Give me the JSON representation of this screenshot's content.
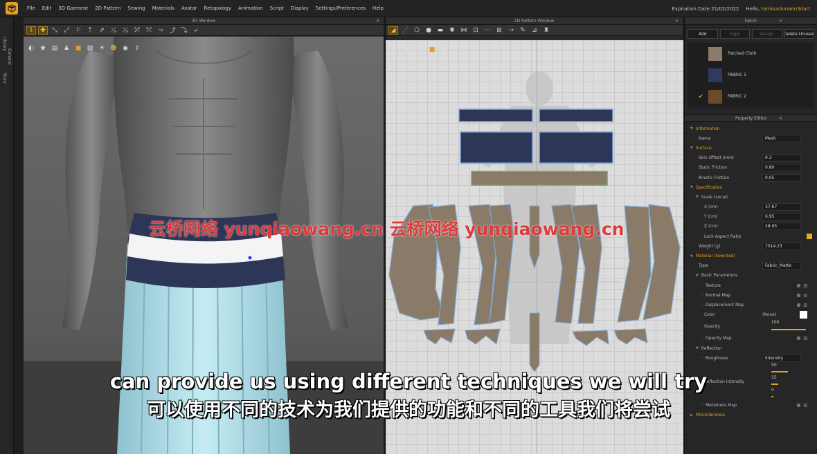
{
  "menubar": {
    "items": [
      "File",
      "Edit",
      "3D Garment",
      "2D Pattern",
      "Sewing",
      "Materials",
      "Avatar",
      "Retopology",
      "Animation",
      "Script",
      "Display",
      "Settings/Preferences",
      "Help"
    ],
    "expiration": "Expiration Date 21/02/2022",
    "hello": "Hello,",
    "username": "tomisackmann3dart"
  },
  "side_tabs": {
    "library": "Library",
    "general": "General",
    "store": "Store"
  },
  "window3d": {
    "title": "3D Window"
  },
  "window2d": {
    "title": "2D Pattern Window"
  },
  "fabric_panel": {
    "title": "Fabric",
    "buttons": [
      "Add",
      "Copy",
      "Assign",
      "Delete Unused"
    ],
    "items": [
      {
        "name": "Patched Cloth",
        "color": "#8a7a6a",
        "selected": false
      },
      {
        "name": "FABRIC 1",
        "color": "#2e3a5e",
        "selected": false
      },
      {
        "name": "FABRIC 2",
        "color": "#6a4a2a",
        "selected": true
      }
    ]
  },
  "property_editor": {
    "title": "Property Editor",
    "rows": [
      {
        "type": "section",
        "label": "Information"
      },
      {
        "type": "field",
        "label": "Name",
        "value": "Mesh"
      },
      {
        "type": "section",
        "label": "Surface"
      },
      {
        "type": "field",
        "label": "Skin Offset (mm)",
        "value": "0.3"
      },
      {
        "type": "field",
        "label": "Static Friction",
        "value": "0.80"
      },
      {
        "type": "field",
        "label": "Kinetic Friction",
        "value": "0.05"
      },
      {
        "type": "section",
        "label": "Specification"
      },
      {
        "type": "sub",
        "label": "Scale (Local)"
      },
      {
        "type": "field",
        "label": "X (cm)",
        "value": "37.67"
      },
      {
        "type": "field",
        "label": "Y (cm)",
        "value": "6.95"
      },
      {
        "type": "field",
        "label": "Z (cm)",
        "value": "28.95"
      },
      {
        "type": "check",
        "label": "Lock Aspect Ratio"
      },
      {
        "type": "field",
        "label": "Weight (g)",
        "value": "7014.23"
      },
      {
        "type": "section",
        "label": "Material (Selected)"
      },
      {
        "type": "field",
        "label": "Type",
        "value": "Fabric_Matte"
      },
      {
        "type": "sub",
        "label": "Basic Parameters"
      },
      {
        "type": "map",
        "label": "Texture"
      },
      {
        "type": "map",
        "label": "Normal Map"
      },
      {
        "type": "map",
        "label": "Displacement Map"
      },
      {
        "type": "color",
        "label": "Color",
        "value": "(None)"
      },
      {
        "type": "slider",
        "label": "Opacity",
        "value": "100"
      },
      {
        "type": "map",
        "label": "Opacity Map"
      },
      {
        "type": "sub",
        "label": "Reflection"
      },
      {
        "type": "field",
        "label": "Roughness",
        "value": "Intensity"
      },
      {
        "type": "slider",
        "label": "",
        "value": "50"
      },
      {
        "type": "slider",
        "label": "Reflection Intensity",
        "value": "15"
      },
      {
        "type": "slider",
        "label": "",
        "value": "0"
      },
      {
        "type": "map",
        "label": "Metalness Map"
      },
      {
        "type": "section",
        "label": "Miscellaneous"
      }
    ]
  },
  "watermark": "云桥网络 yunqiaowang.cn 云桥网络 yunqiaowang.cn",
  "subtitles": {
    "english": "can provide us using different techniques we will try",
    "chinese": "可以使用不同的技术为我们提供的功能和不同的工具我们将尝试"
  },
  "accent_color": "#e0a020"
}
